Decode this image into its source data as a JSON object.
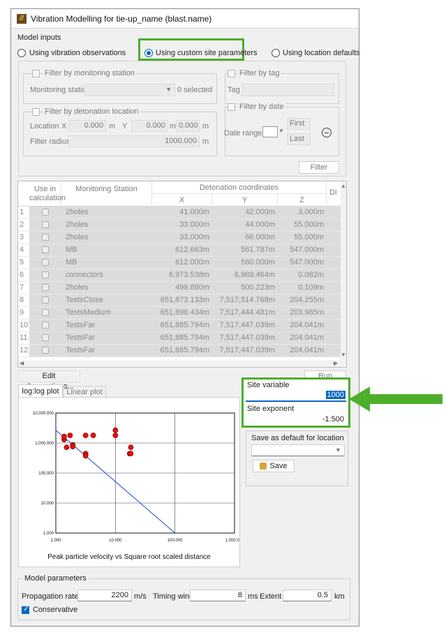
{
  "window": {
    "title": "Vibration Modelling for tie-up_name (blast.name)"
  },
  "model_inputs": {
    "label": "Model inputs",
    "radios": [
      {
        "label": "Using vibration observations",
        "selected": false
      },
      {
        "label": "Using custom site parameters",
        "selected": true
      },
      {
        "label": "Using location defaults",
        "selected": false
      }
    ]
  },
  "filters": {
    "monitoring_station_check": "Filter by monitoring station",
    "monitoring_station_label": "Monitoring station",
    "selected_count": "0 selected",
    "tag_check": "Filter by tag",
    "tag_label": "Tag",
    "detonation_check": "Filter by detonation location",
    "location_label": "Location",
    "x_label": "X",
    "x_value": "0.000",
    "x_unit": "m",
    "y_label": "Y",
    "y_value": "0.000",
    "y_unit": "m",
    "z_label": "Z",
    "z_value": "0.000",
    "z_unit": "m",
    "radius_label": "Filter radius",
    "radius_value": "1000.000",
    "radius_unit": "m",
    "date_check": "Filter by date",
    "date_range_label": "Date range",
    "first_label": "First",
    "last_label": "Last",
    "filter_button": "Filter"
  },
  "table": {
    "headers": {
      "use": "Use in calculation",
      "station": "Monitoring Station",
      "detonation": "Detonation coordinates",
      "x": "X",
      "y": "Y",
      "z": "Z",
      "di": "Di"
    },
    "rows": [
      {
        "n": "1",
        "station": "2holes",
        "x": "41.000m",
        "y": "42.000m",
        "z": "3.000m"
      },
      {
        "n": "2",
        "station": "2holes",
        "x": "33.000m",
        "y": "44.000m",
        "z": "55.000m"
      },
      {
        "n": "3",
        "station": "2holes",
        "x": "33.000m",
        "y": "66.000m",
        "z": "55.000m"
      },
      {
        "n": "4",
        "station": "MB",
        "x": "612.663m",
        "y": "561.787m",
        "z": "547.000m"
      },
      {
        "n": "5",
        "station": "MB",
        "x": "612.000m",
        "y": "560.000m",
        "z": "547.000m"
      },
      {
        "n": "6",
        "station": "connectors",
        "x": "6,973.538m",
        "y": "6,989.464m",
        "z": "0.082m"
      },
      {
        "n": "7",
        "station": "2holes",
        "x": "499.880m",
        "y": "500.223m",
        "z": "0.109m"
      },
      {
        "n": "8",
        "station": "TestsClose",
        "x": "651,873.133m",
        "y": "7,517,514.768m",
        "z": "204.255m"
      },
      {
        "n": "9",
        "station": "TestsMedium",
        "x": "651,898.434m",
        "y": "7,517,444.481m",
        "z": "203.985m"
      },
      {
        "n": "10",
        "station": "TestsFar",
        "x": "651,885.794m",
        "y": "7,517,447.039m",
        "z": "204.041m"
      },
      {
        "n": "11",
        "station": "TestsFar",
        "x": "651,885.794m",
        "y": "7,517,447.039m",
        "z": "204.041m"
      },
      {
        "n": "12",
        "station": "TestsFar",
        "x": "651,885.794m",
        "y": "7,517,447.039m",
        "z": "204.041m"
      }
    ]
  },
  "actions": {
    "edit_observations": "Edit observations...",
    "run": "Run"
  },
  "plot_tabs": [
    "log:log plot",
    "Linear plot"
  ],
  "chart_data": {
    "type": "scatter",
    "title": "Peak particle velocity vs Square root scaled distance",
    "x_scale": "log",
    "y_scale": "log",
    "xlim": [
      1,
      1000000
    ],
    "ylim": [
      1,
      10000000
    ],
    "x_ticks": [
      "1.000",
      "10.000",
      "100.000",
      "1,000.000"
    ],
    "y_ticks": [
      "10,000,000",
      "1,000,000",
      "100,000",
      "10,000",
      "1.000"
    ],
    "points": [
      [
        1.9,
        280000
      ],
      [
        1.9,
        430000
      ],
      [
        2.3,
        100000
      ],
      [
        3.0,
        500000
      ],
      [
        3.7,
        140000
      ],
      [
        3.7,
        110000
      ],
      [
        10,
        500000
      ],
      [
        10,
        43000
      ],
      [
        10,
        32000
      ],
      [
        18,
        500000
      ],
      [
        100,
        1000000
      ],
      [
        100,
        500000
      ],
      [
        330,
        100000
      ],
      [
        300,
        43000
      ],
      [
        330,
        43000
      ]
    ],
    "fit_line": [
      [
        1,
        1000000
      ],
      [
        10000,
        1
      ]
    ],
    "point_color": "#e01010",
    "line_color": "#2244dd",
    "grid": true
  },
  "site": {
    "variable_label": "Site variable",
    "variable_value": "1000",
    "exponent_label": "Site exponent",
    "exponent_value": "-1.500",
    "save_default_label": "Save as default for location",
    "save_button": "Save"
  },
  "model_parameters": {
    "label": "Model parameters",
    "propagation_label": "Propagation rate",
    "propagation_value": "2200",
    "propagation_unit": "m/s",
    "timing_label": "Timing window",
    "timing_value": "8",
    "timing_unit": "ms",
    "extent_label": "Extent",
    "extent_value": "0.5",
    "extent_unit": "km",
    "conservative_label": "Conservative",
    "conservative_checked": true
  },
  "colors": {
    "highlight": "#4caf2a",
    "accent": "#0a66c2",
    "arrow": "#4caf2a"
  }
}
